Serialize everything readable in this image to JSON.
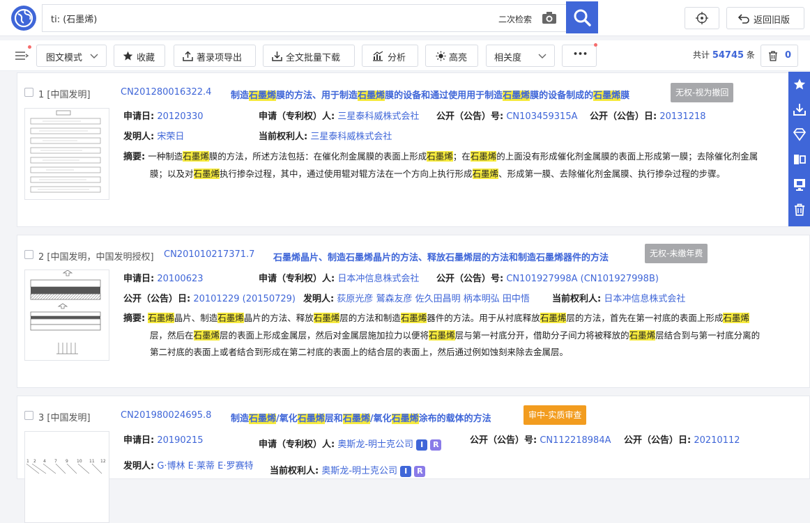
{
  "search": {
    "query": "ti: (石墨烯)",
    "second_search": "二次检索",
    "back_old": "返回旧版"
  },
  "toolbar": {
    "view_mode": "图文模式",
    "favorite": "收藏",
    "export": "著录项导出",
    "download": "全文批量下载",
    "analyze": "分析",
    "highlight": "高亮",
    "sort": "相关度",
    "more": "•••",
    "total_prefix": "共计",
    "total_count": "54745",
    "total_suffix": "条",
    "trash_count": "0"
  },
  "results": [
    {
      "index": "1",
      "type": "[中国发明]",
      "pn": "CN201280016322.4",
      "title_parts": [
        "制造",
        "石墨烯",
        "膜的方法、用于制造",
        "石墨烯",
        "膜的设备和通过使用用于制造",
        "石墨烯",
        "膜的设备制成的",
        "石墨烯",
        "膜"
      ],
      "badge": "无权-视为撤回",
      "apply_date_label": "申请日:",
      "apply_date": "20120330",
      "applicant_label": "申请（专利权）人:",
      "applicant": "三星泰科威株式会社",
      "pub_no_label": "公开（公告）号:",
      "pub_no": "CN103459315A",
      "pub_date_label": "公开（公告）日:",
      "pub_date": "20131218",
      "inventor_label": "发明人:",
      "inventor": "宋荣日",
      "owner_label": "当前权利人:",
      "owner": "三星泰科威株式会社",
      "abstract_label": "摘要:",
      "abstract_line1": [
        "一种制造",
        "石墨烯",
        "膜的方法，所述方法包括：在催化剂金属膜的表面上形成",
        "石墨烯",
        "；在",
        "石墨烯",
        "的上面没有形成催化剂金属膜的表面上形成第一膜；去除催化剂金属"
      ],
      "abstract_line2": [
        "膜；以及对",
        "石墨烯",
        "执行掺杂过程，其中，通过使用辊对辊方法在一个方向上执行形成",
        "石墨烯",
        "、形成第一膜、去除催化剂金属膜、执行掺杂过程的步骤。"
      ]
    },
    {
      "index": "2",
      "type": "[中国发明，中国发明授权]",
      "pn": "CN201010217371.7",
      "title_parts": [
        "石墨烯晶片、制造石墨烯晶片的方法、释放石墨烯层的方法和制造石墨烯器件的方法"
      ],
      "badge": "无权-未缴年费",
      "apply_date_label": "申请日:",
      "apply_date": "20100623",
      "applicant_label": "申请（专利权）人:",
      "applicant": "日本冲信息株式会社",
      "pub_no_label": "公开（公告）号:",
      "pub_no": "CN101927998A",
      "pub_no_extra": "CN101927998B",
      "pub_date_label": "公开（公告）日:",
      "pub_date": "20101229",
      "pub_date_extra": "20150729",
      "inventor_label": "发明人:",
      "inventor": "荻原光彦 鷲森友彦 佐久田昌明 柄本明弘 田中悟",
      "owner_label": "当前权利人:",
      "owner": "日本冲信息株式会社",
      "abstract_label": "摘要:",
      "abstract_line1": [
        "石墨烯",
        "晶片、制造",
        "石墨烯",
        "晶片的方法、释放",
        "石墨烯",
        "层的方法和制造",
        "石墨烯",
        "器件的方法。用于从衬底释放",
        "石墨烯",
        "层的方法，首先在第一衬底的表面上形成",
        "石墨烯"
      ],
      "abstract_line2": [
        "层，然后在",
        "石墨烯",
        "层的表面上形成金属层，然后对金属层施加拉力以便将",
        "石墨烯",
        "层与第一衬底分开，借助分子间力将被释放的",
        "石墨烯",
        "层结合到与第一衬底分离的"
      ],
      "abstract_line3": "第二衬底的表面上或者结合到形成在第二衬底的表面上的结合层的表面上，然后通过例如蚀刻来除去金属层。"
    },
    {
      "index": "3",
      "type": "[中国发明]",
      "pn": "CN201980024695.8",
      "title_parts": [
        "制造",
        "石墨烯",
        "/氧化",
        "石墨烯",
        "层和",
        "石墨烯",
        "/氧化",
        "石墨烯",
        "涂布的载体的方法"
      ],
      "badge": "审中-实质审查",
      "apply_date_label": "申请日:",
      "apply_date": "20190215",
      "applicant_label": "申请（专利权）人:",
      "applicant": "奥斯龙-明士克公司",
      "pub_no_label": "公开（公告）号:",
      "pub_no": "CN112218984A",
      "pub_date_label": "公开（公告）日:",
      "pub_date": "20210112",
      "inventor_label": "发明人:",
      "inventor": "G·博林 E·莱蒂 E·罗赛特",
      "owner_label": "当前权利人:",
      "owner": "奥斯龙-明士克公司",
      "tag_i": "I",
      "tag_r": "R"
    }
  ],
  "colors": {
    "brand": "#3f66d8",
    "highlight": "#f6ea3c",
    "badge_gray": "#a7a8ab",
    "badge_orange": "#f29c1f"
  },
  "icons": [
    "globe-logo-icon",
    "camera-icon",
    "search-icon",
    "crosshair-icon",
    "undo-icon",
    "menu-icon",
    "star-icon",
    "upload-icon",
    "download-icon",
    "chart-icon",
    "sun-icon",
    "chevron-down-icon",
    "trash-icon"
  ]
}
